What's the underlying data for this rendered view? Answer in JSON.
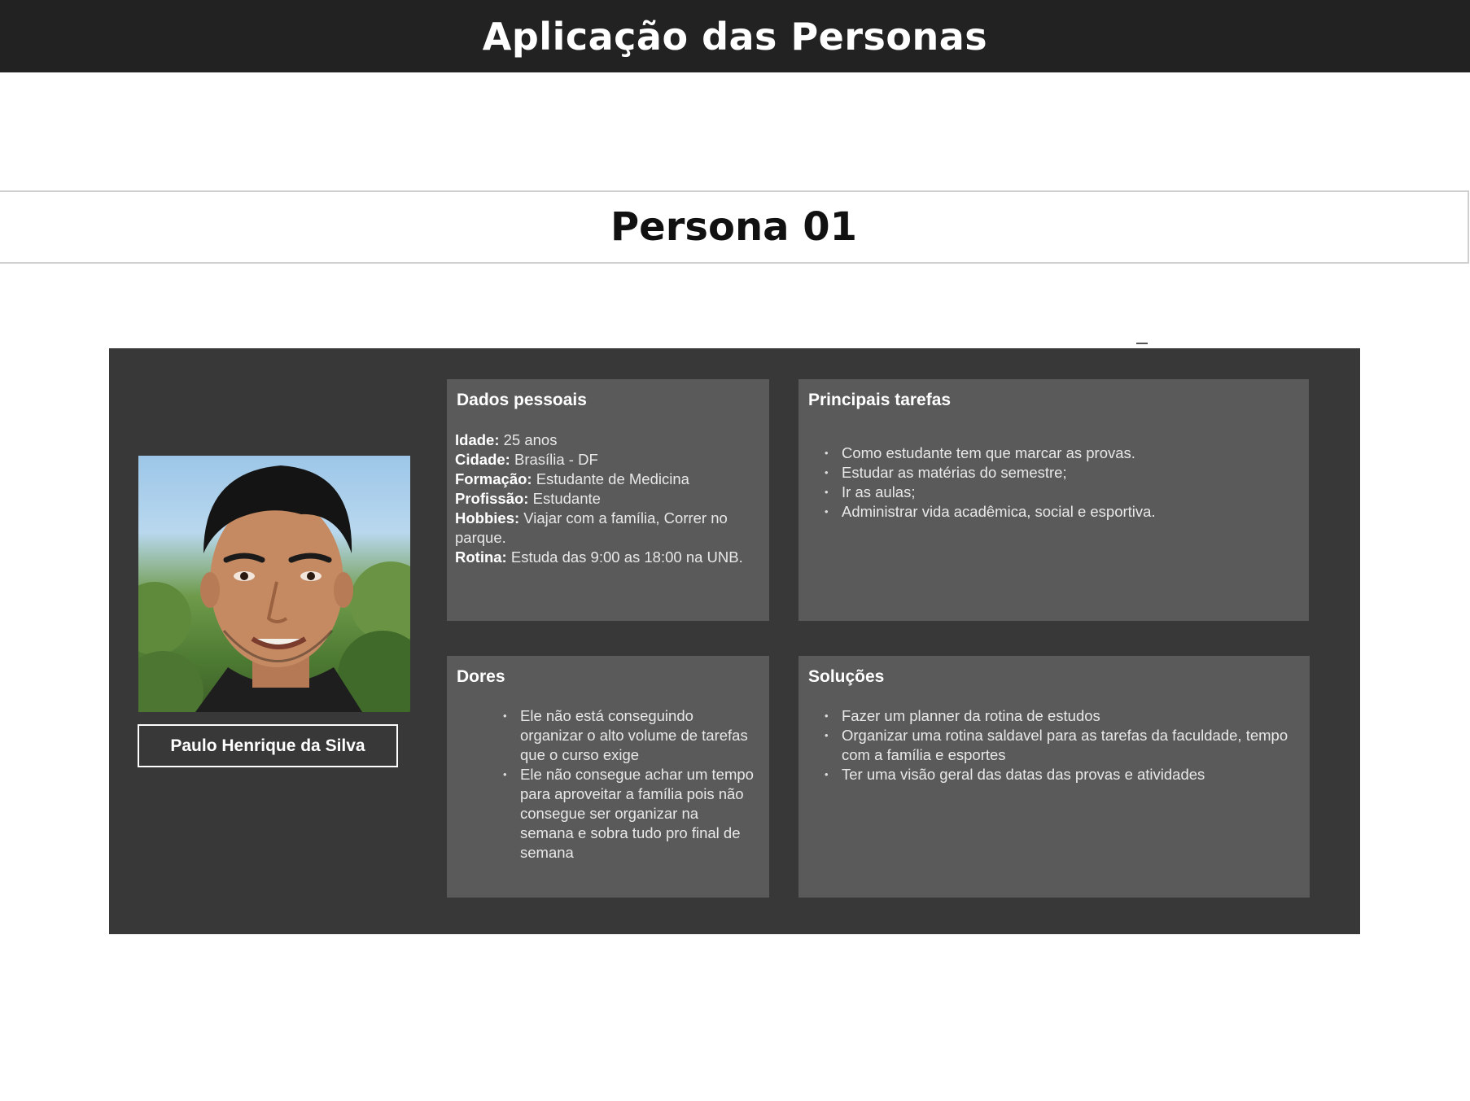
{
  "header": {
    "title": "Aplicação das Personas"
  },
  "persona_bar": {
    "title": "Persona 01"
  },
  "persona": {
    "name": "Paulo Henrique da Silva",
    "dados": {
      "title": "Dados pessoais",
      "rows": [
        {
          "label": "Idade:",
          "value": " 25 anos"
        },
        {
          "label": "Cidade:",
          "value": " Brasília - DF"
        },
        {
          "label": "Formação:",
          "value": " Estudante de Medicina"
        },
        {
          "label": "Profissão:",
          "value": " Estudante"
        },
        {
          "label": "Hobbies:",
          "value": " Viajar com a família, Correr no parque."
        },
        {
          "label": "Rotina:",
          "value": " Estuda das 9:00 as 18:00 na UNB."
        }
      ]
    },
    "tarefas": {
      "title": "Principais tarefas",
      "items": [
        "Como estudante tem que marcar as provas.",
        "Estudar as matérias do semestre;",
        "Ir as aulas;",
        "Administrar vida acadêmica, social e esportiva."
      ]
    },
    "dores": {
      "title": "Dores",
      "items": [
        "Ele não está conseguindo organizar o alto volume de tarefas que o curso exige",
        "Ele não consegue achar um tempo para aproveitar a família pois não consegue ser organizar na semana e sobra tudo pro final de semana"
      ]
    },
    "solucoes": {
      "title": "Soluções",
      "items": [
        "Fazer um planner da rotina de estudos",
        "Organizar uma rotina saldavel para as tarefas da faculdade, tempo com a família e esportes",
        "Ter uma visão geral das datas das provas e atividades"
      ]
    }
  },
  "colors": {
    "header_bg": "#222222",
    "panel_bg": "#383838",
    "card_bg": "#5a5a5a"
  }
}
